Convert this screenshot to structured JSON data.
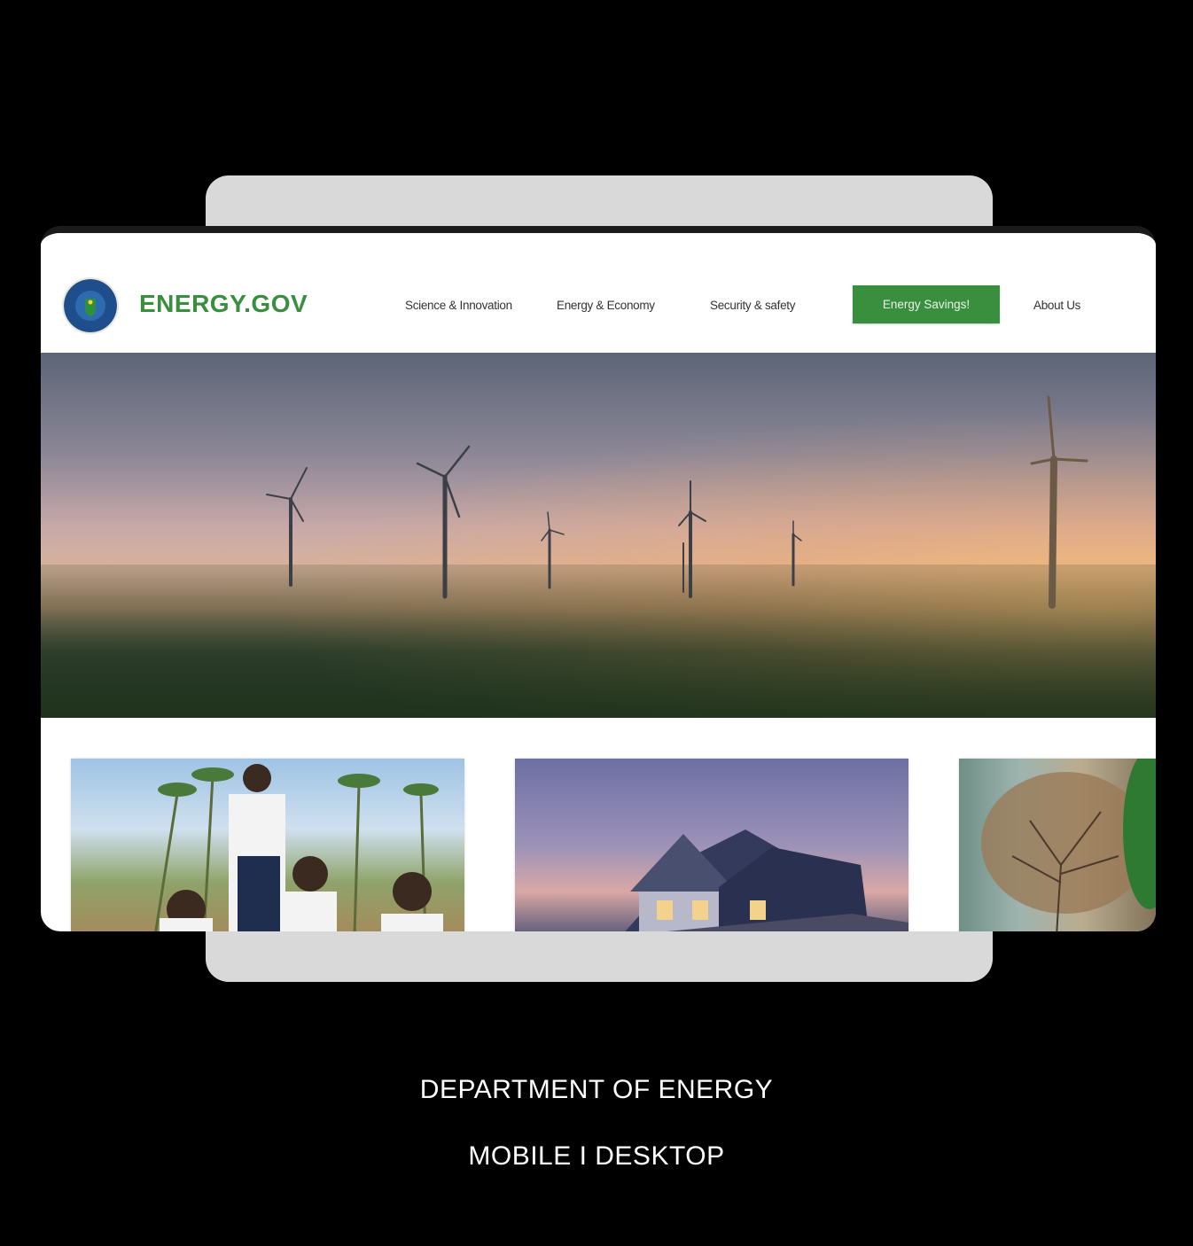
{
  "site": {
    "logo_text": "ENERGY.GOV"
  },
  "nav": {
    "items": [
      {
        "label": "Science & Innovation"
      },
      {
        "label": "Energy & Economy"
      },
      {
        "label": "Security & safety"
      },
      {
        "label": "Energy Savings!"
      },
      {
        "label": "About Us"
      }
    ]
  },
  "colors": {
    "brand_green": "#3a8f3e",
    "page_background": "#000000",
    "back_card": "#d9d9d9"
  },
  "captions": {
    "title": "DEPARTMENT OF ENERGY",
    "subtitle": "MOBILE I DESKTOP"
  },
  "images": {
    "hero": "wind-farm-at-sunrise",
    "card_1": "students-planting-trees",
    "card_2": "house-at-dusk",
    "card_3": "tree-half-green"
  }
}
